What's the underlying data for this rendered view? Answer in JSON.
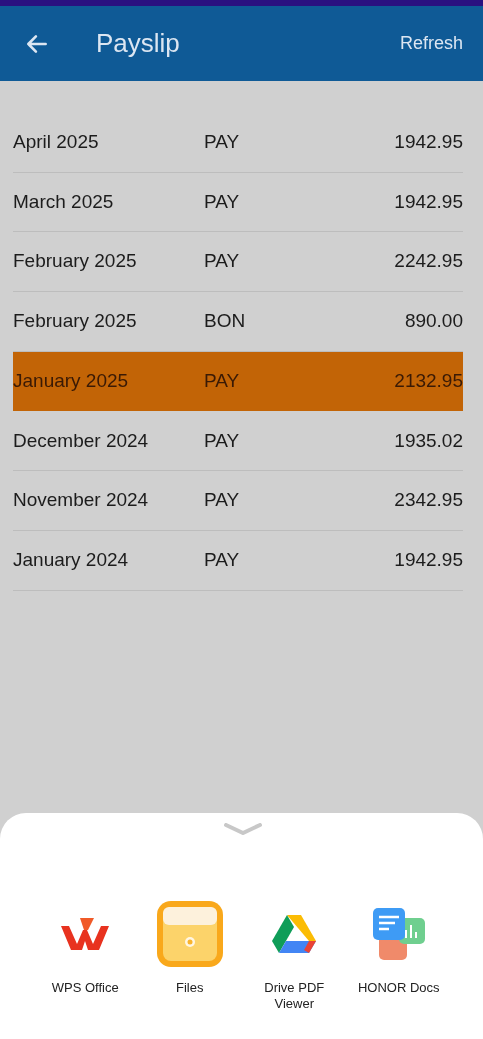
{
  "header": {
    "title": "Payslip",
    "action": "Refresh"
  },
  "payslips": [
    {
      "period": "April 2025",
      "type": "PAY",
      "amount": "1942.95",
      "selected": false
    },
    {
      "period": "March 2025",
      "type": "PAY",
      "amount": "1942.95",
      "selected": false
    },
    {
      "period": "February 2025",
      "type": "PAY",
      "amount": "2242.95",
      "selected": false
    },
    {
      "period": "February 2025",
      "type": "BON",
      "amount": "890.00",
      "selected": false
    },
    {
      "period": "January 2025",
      "type": "PAY",
      "amount": "2132.95",
      "selected": true
    },
    {
      "period": "December 2024",
      "type": "PAY",
      "amount": "1935.02",
      "selected": false
    },
    {
      "period": "November 2024",
      "type": "PAY",
      "amount": "2342.95",
      "selected": false
    },
    {
      "period": "January 2024",
      "type": "PAY",
      "amount": "1942.95",
      "selected": false
    }
  ],
  "open_with": [
    {
      "kind": "wps",
      "label": "WPS Office"
    },
    {
      "kind": "files",
      "label": "Files"
    },
    {
      "kind": "drive",
      "label": "Drive PDF Viewer"
    },
    {
      "kind": "docs",
      "label": "HONOR Docs"
    }
  ]
}
